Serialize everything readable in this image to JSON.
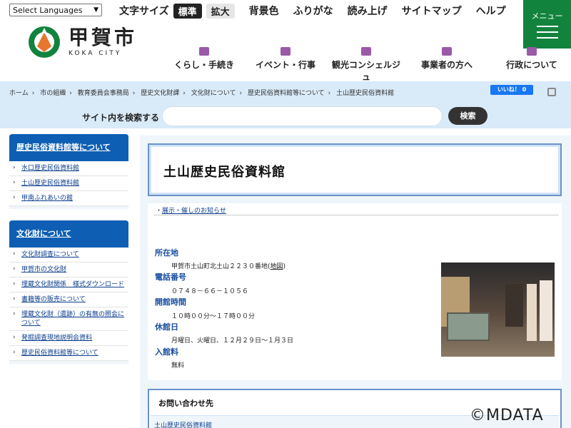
{
  "header": {
    "language_select": "Select Languages",
    "tools": {
      "font_size": "文字サイズ",
      "standard": "標準",
      "large": "拡大",
      "background": "背景色",
      "furigana": "ふりがな",
      "read_aloud": "読み上げ",
      "sitemap": "サイトマップ",
      "help": "ヘルプ"
    },
    "menu_label": "メニュー",
    "logo_jp": "甲賀市",
    "logo_en": "KOKA CITY",
    "nav": [
      "くらし・手続き",
      "イベント・行事",
      "観光コンシェルジュ",
      "事業者の方へ",
      "行政について"
    ]
  },
  "breadcrumb": [
    "ホーム",
    "市の組織",
    "教育委員会事務局",
    "歴史文化財課",
    "文化財について",
    "歴史民俗資料館等について",
    "土山歴史民俗資料館"
  ],
  "fb_like": "いいね！ 0",
  "search": {
    "label": "サイト内を検索する",
    "placeholder": "",
    "button": "検索"
  },
  "sidebar": {
    "blocks": [
      {
        "title": "歴史民俗資料館等について",
        "items": [
          "水口歴史民俗資料館",
          "土山歴史民俗資料館",
          "甲南ふれあいの館"
        ]
      },
      {
        "title": "文化財について",
        "items": [
          "文化財調査について",
          "甲賀市の文化財",
          "埋蔵文化財関係　様式ダウンロード",
          "書籍等の販売について",
          "埋蔵文化財（遺跡）の有無の照会について",
          "発掘調査現地説明会資料",
          "歴史民俗資料館等について"
        ]
      }
    ]
  },
  "page_title": "土山歴史民俗資料館",
  "notice": {
    "bullet": "・",
    "link": "展示・催しのお知らせ"
  },
  "info": {
    "location_label": "所在地",
    "location_value": "甲賀市土山町北土山２２３０番地(",
    "location_map": "地図",
    "location_close": ")",
    "phone_label": "電話番号",
    "phone_value": "０７４８－６６－１０５６",
    "hours_label": "開館時間",
    "hours_value": "１０時００分～１７時００分",
    "closed_label": "休館日",
    "closed_value": "月曜日、火曜日、１２月２９日～１月３日",
    "fee_label": "入館料",
    "fee_value": "無料"
  },
  "contact": {
    "heading": "お問い合わせ先",
    "link": "土山歴史民俗資料館"
  },
  "watermark": "©MDATA",
  "colors": {
    "accent_green": "#12833d",
    "nav_blue": "#0e5fb3",
    "crumb_bg": "#d9eaf8"
  }
}
